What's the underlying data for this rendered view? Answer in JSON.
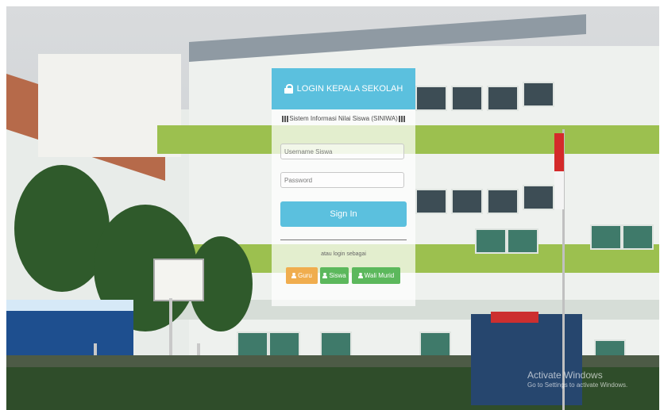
{
  "login": {
    "title": "LOGIN KEPALA SEKOLAH",
    "subtitle": "Sistem Informasi Nilai Siswa (SINIWA)",
    "username_placeholder": "Username Siswa",
    "password_placeholder": "Password",
    "signin_label": "Sign In",
    "login_as_text": "atau login sebagai",
    "roles": [
      "Guru",
      "Siswa",
      "Wali Murid"
    ]
  },
  "watermark": {
    "title": "Activate Windows",
    "subtitle": "Go to Settings to activate Windows."
  },
  "colors": {
    "header": "#5bc0de",
    "signin": "#5bc0de",
    "guru": "#f0ad4e",
    "siswa": "#5cb85c",
    "wali": "#5cb85c"
  },
  "icons": {
    "title": "lock-icon",
    "subtitle": "qrcode-icon",
    "roles": "user-icon"
  }
}
